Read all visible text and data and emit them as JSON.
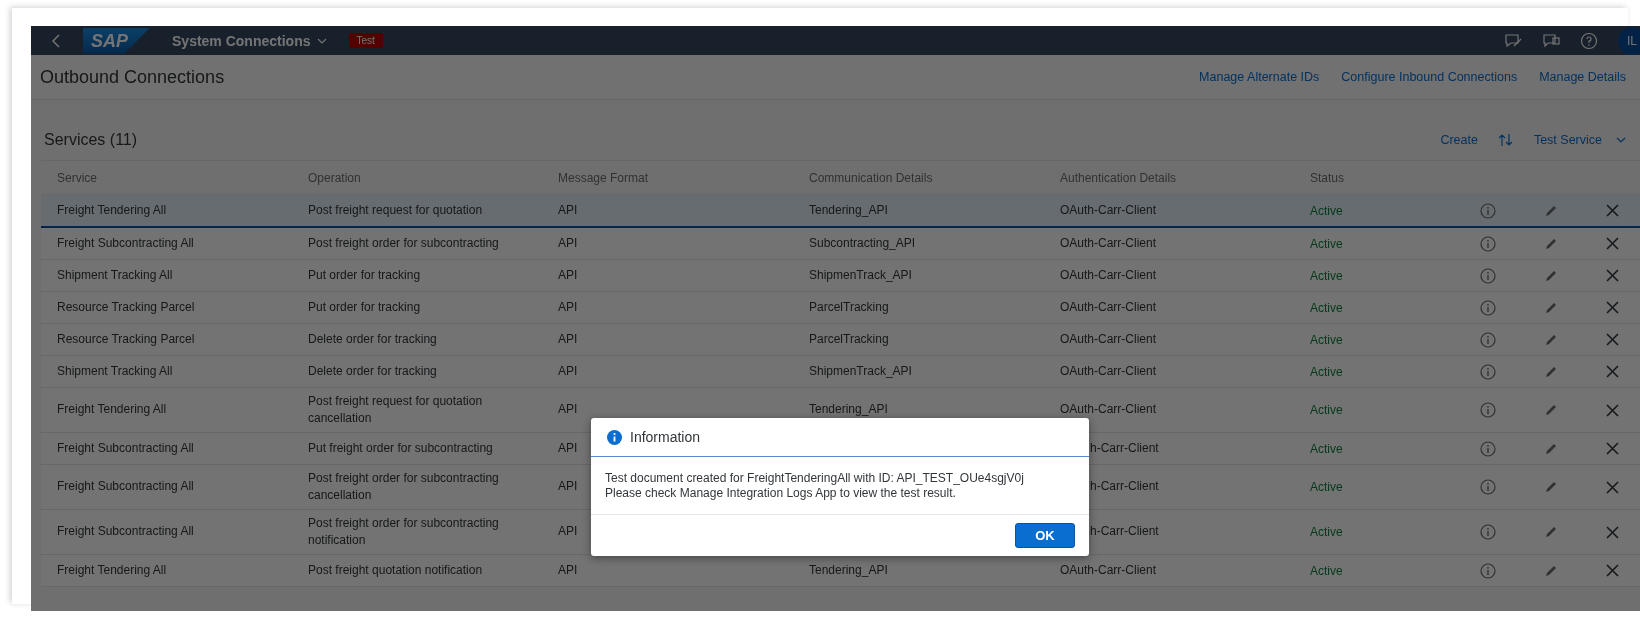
{
  "shell": {
    "logo": "SAP",
    "title": "System Connections",
    "badge": "Test",
    "avatar": "IL"
  },
  "page": {
    "title": "Outbound Connections",
    "links": [
      "Manage Alternate IDs",
      "Configure Inbound Connections",
      "Manage Details"
    ]
  },
  "services": {
    "title": "Services (11)",
    "actions": [
      {
        "kind": "link",
        "label": "Create"
      },
      {
        "kind": "sort"
      },
      {
        "kind": "menu",
        "label": "Test Service"
      }
    ],
    "columns": [
      "Service",
      "Operation",
      "Message Format",
      "Communication Details",
      "Authentication Details",
      "Status"
    ],
    "rows": [
      {
        "service": "Freight Tendering All",
        "operation": "Post freight request for quotation",
        "format": "API",
        "communication": "Tendering_API",
        "authentication": "OAuth-Carr-Client",
        "status": "Active",
        "selected": true
      },
      {
        "service": "Freight Subcontracting All",
        "operation": "Post freight order for subcontracting",
        "format": "API",
        "communication": "Subcontracting_API",
        "authentication": "OAuth-Carr-Client",
        "status": "Active",
        "selected": false
      },
      {
        "service": "Shipment Tracking All",
        "operation": "Put order for tracking",
        "format": "API",
        "communication": "ShipmenTrack_API",
        "authentication": "OAuth-Carr-Client",
        "status": "Active",
        "selected": false
      },
      {
        "service": "Resource Tracking Parcel",
        "operation": "Put order for tracking",
        "format": "API",
        "communication": "ParcelTracking",
        "authentication": "OAuth-Carr-Client",
        "status": "Active",
        "selected": false
      },
      {
        "service": "Resource Tracking Parcel",
        "operation": "Delete order for tracking",
        "format": "API",
        "communication": "ParcelTracking",
        "authentication": "OAuth-Carr-Client",
        "status": "Active",
        "selected": false
      },
      {
        "service": "Shipment Tracking All",
        "operation": "Delete order for tracking",
        "format": "API",
        "communication": "ShipmenTrack_API",
        "authentication": "OAuth-Carr-Client",
        "status": "Active",
        "selected": false
      },
      {
        "service": "Freight Tendering All",
        "operation": "Post freight request for quotation cancellation",
        "format": "API",
        "communication": "Tendering_API",
        "authentication": "OAuth-Carr-Client",
        "status": "Active",
        "selected": false
      },
      {
        "service": "Freight Subcontracting All",
        "operation": "Put freight order for subcontracting",
        "format": "API",
        "authentication": "h-Carr-Client",
        "status": "Active",
        "selected": false
      },
      {
        "service": "Freight Subcontracting All",
        "operation": "Post freight order for subcontracting cancellation",
        "format": "API",
        "authentication": "h-Carr-Client",
        "status": "Active",
        "selected": false
      },
      {
        "service": "Freight Subcontracting All",
        "operation": "Post freight order for subcontracting notification",
        "format": "API",
        "authentication": "h-Carr-Client",
        "status": "Active",
        "selected": false
      },
      {
        "service": "Freight Tendering All",
        "operation": "Post freight quotation notification",
        "format": "API",
        "communication": "Tendering_API",
        "authentication": "OAuth-Carr-Client",
        "status": "Active",
        "selected": false
      }
    ]
  },
  "dialog": {
    "title": "Information",
    "message_lines": [
      "Test document created for FreightTenderingAll with ID: API_TEST_OUe4sgjV0j",
      "Please check Manage Integration Logs App to view the test result."
    ],
    "button": "OK"
  }
}
